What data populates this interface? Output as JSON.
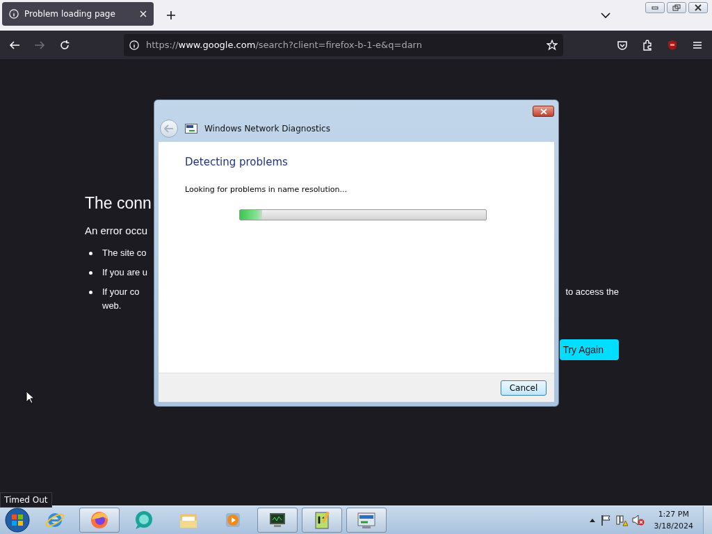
{
  "browser": {
    "tab": {
      "title": "Problem loading page",
      "selected": true
    },
    "url": {
      "host": "www.google.com",
      "prefix": "https://",
      "path": "/search?client=firefox-b-1-e&q=darn"
    },
    "forward_disabled": true
  },
  "error_page": {
    "title": "The conn",
    "subtitle": "An error occu",
    "bullets": [
      {
        "left": "The site co"
      },
      {
        "left": "If you are u"
      },
      {
        "left": "If your co",
        "right": "to access the",
        "continuation": "web."
      }
    ],
    "button": "Try Again"
  },
  "dialog": {
    "title": "Windows Network Diagnostics",
    "heading": "Detecting problems",
    "message": "Looking for problems in name resolution...",
    "progress": {
      "level": 0.09
    },
    "cancel": "Cancel"
  },
  "tooltip": "Timed Out",
  "taskbar": {
    "apps": [
      {
        "kind": "ie",
        "running": false
      },
      {
        "kind": "firefox",
        "running": true
      },
      {
        "kind": "chat",
        "running": false
      },
      {
        "kind": "folder",
        "running": false
      },
      {
        "kind": "media",
        "running": false
      },
      {
        "kind": "monitor",
        "running": true
      },
      {
        "kind": "notepad",
        "running": true
      },
      {
        "kind": "network",
        "running": true
      }
    ],
    "time": "1:27 PM",
    "date": "3/18/2024"
  }
}
